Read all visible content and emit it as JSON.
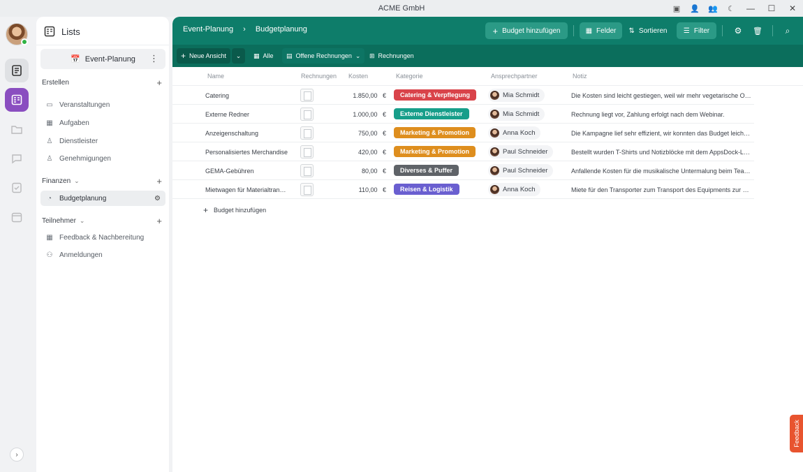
{
  "window": {
    "title": "ACME GmbH"
  },
  "sidebar": {
    "title": "Lists",
    "workspace": "Event-Planung",
    "sections": [
      {
        "label": "Erstellen",
        "items": [
          "Veranstaltungen",
          "Aufgaben",
          "Dienstleister",
          "Genehmigungen"
        ]
      },
      {
        "label": "Finanzen",
        "items": [
          "Budgetplanung"
        ]
      },
      {
        "label": "Teilnehmer",
        "items": [
          "Feedback & Nachbereitung",
          "Anmeldungen"
        ]
      }
    ]
  },
  "header": {
    "breadcrumb": [
      "Event-Planung",
      "Budgetplanung"
    ],
    "add_label": "Budget hinzufügen",
    "fields_label": "Felder",
    "sort_label": "Sortieren",
    "filter_label": "Filter"
  },
  "views": {
    "new_view_label": "Neue Ansicht",
    "tabs": [
      "Alle",
      "Offene Rechnungen",
      "Rechnungen"
    ]
  },
  "table": {
    "columns": [
      "Name",
      "Rechnungen",
      "Kosten",
      "Kategorie",
      "Ansprechpartner",
      "Notiz"
    ],
    "rows": [
      {
        "name": "Catering",
        "cost": "1.850,00",
        "currency": "€",
        "category": "Catering & Verpflegung",
        "category_color": "#d9434a",
        "contact": "Mia Schmidt",
        "note": "Die Kosten sind leicht gestiegen, weil wir mehr vegetarische Opti..."
      },
      {
        "name": "Externe Redner",
        "cost": "1.000,00",
        "currency": "€",
        "category": "Externe Dienstleister",
        "category_color": "#179e8a",
        "contact": "Mia Schmidt",
        "note": "Rechnung liegt vor, Zahlung erfolgt nach dem Webinar."
      },
      {
        "name": "Anzeigenschaltung",
        "cost": "750,00",
        "currency": "€",
        "category": "Marketing & Promotion",
        "category_color": "#de8e1e",
        "contact": "Anna Koch",
        "note": "Die Kampagne lief sehr effizient, wir konnten das Budget leicht u..."
      },
      {
        "name": "Personalisiertes Merchandise",
        "cost": "420,00",
        "currency": "€",
        "category": "Marketing & Promotion",
        "category_color": "#de8e1e",
        "contact": "Paul Schneider",
        "note": "Bestellt wurden T-Shirts und Notizblöcke mit dem AppsDock-Log..."
      },
      {
        "name": "GEMA-Gebühren",
        "cost": "80,00",
        "currency": "€",
        "category": "Diverses & Puffer",
        "category_color": "#5f6368",
        "contact": "Paul Schneider",
        "note": "Anfallende Kosten für die musikalische Untermalung beim Team-..."
      },
      {
        "name": "Mietwagen für Materialtransp...",
        "cost": "110,00",
        "currency": "€",
        "category": "Reisen & Logistik",
        "category_color": "#6a5fd0",
        "contact": "Anna Koch",
        "note": "Miete für den Transporter zum Transport des Equipments zur Loc..."
      }
    ],
    "add_row_label": "Budget hinzufügen"
  },
  "feedback_label": "Feedback",
  "colors": {
    "accent": "#0e7d6a",
    "purple": "#8a4ec0"
  }
}
